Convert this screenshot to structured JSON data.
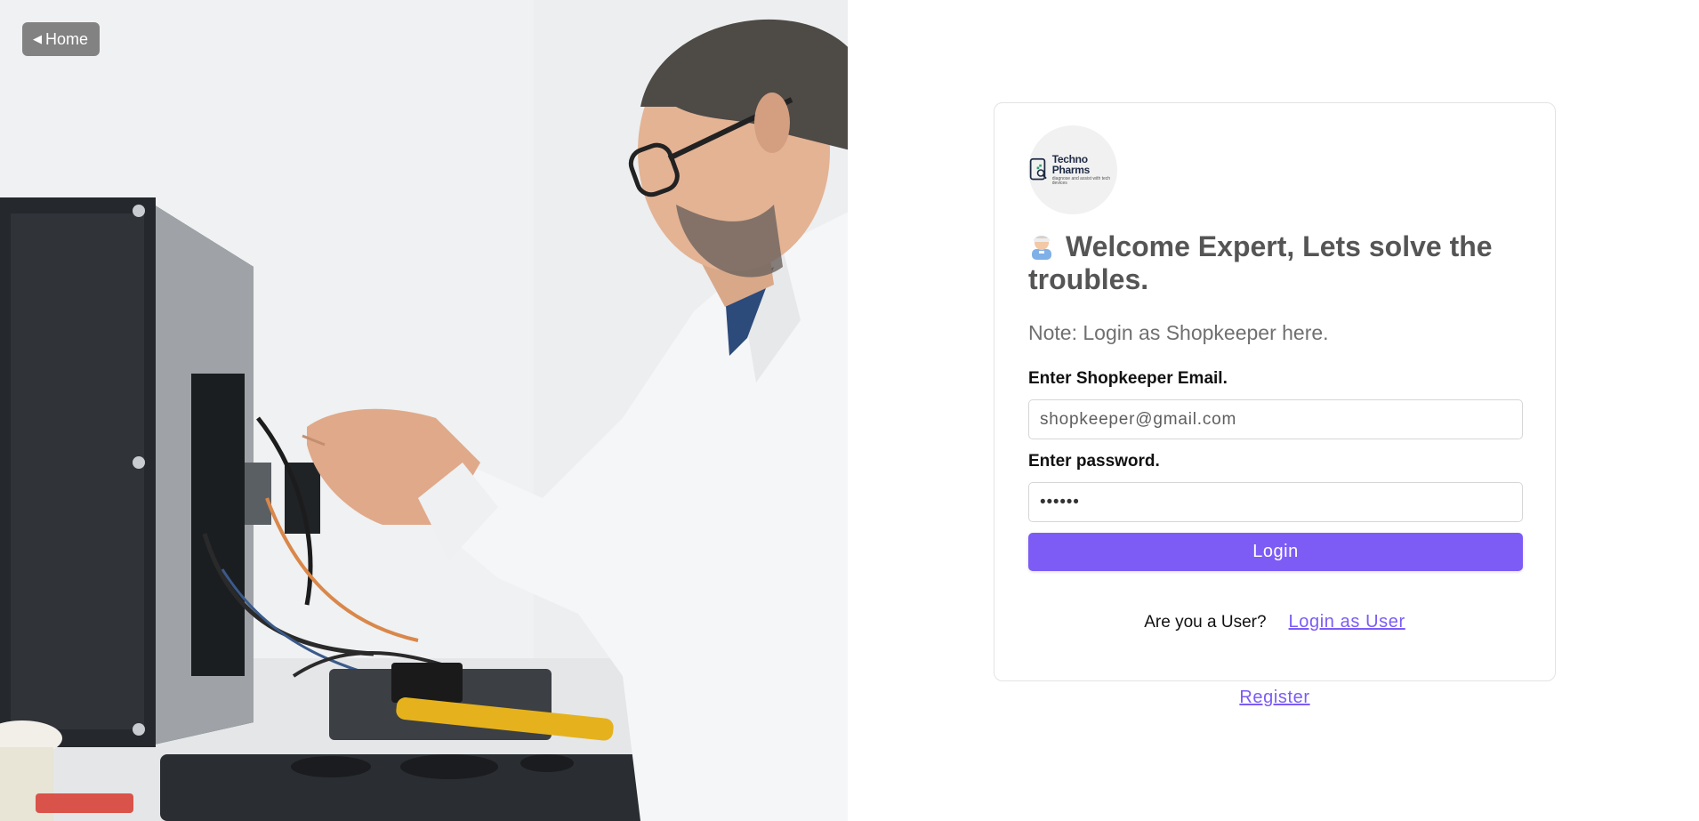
{
  "nav": {
    "home_label": "Home",
    "home_icon": "back-triangle-icon"
  },
  "hero": {
    "description_icon": "technician-photo"
  },
  "brand": {
    "logo_line1": "Techno",
    "logo_line2": "Pharms",
    "logo_tagline": "diagnose and assist with tech devices"
  },
  "form": {
    "welcome_title": "Welcome Expert, Lets solve the troubles.",
    "note": "Note: Login as Shopkeeper here.",
    "email_label": "Enter Shopkeeper Email.",
    "email_placeholder": "shopkeeper@gmail.com",
    "password_label": "Enter password.",
    "password_value": "••••••",
    "login_button": "Login",
    "user_question": "Are you a User?",
    "user_login_link": "Login as User",
    "register_link": "Register"
  },
  "colors": {
    "accent": "#7c5cf5",
    "heading": "#555555",
    "note": "#707070"
  }
}
